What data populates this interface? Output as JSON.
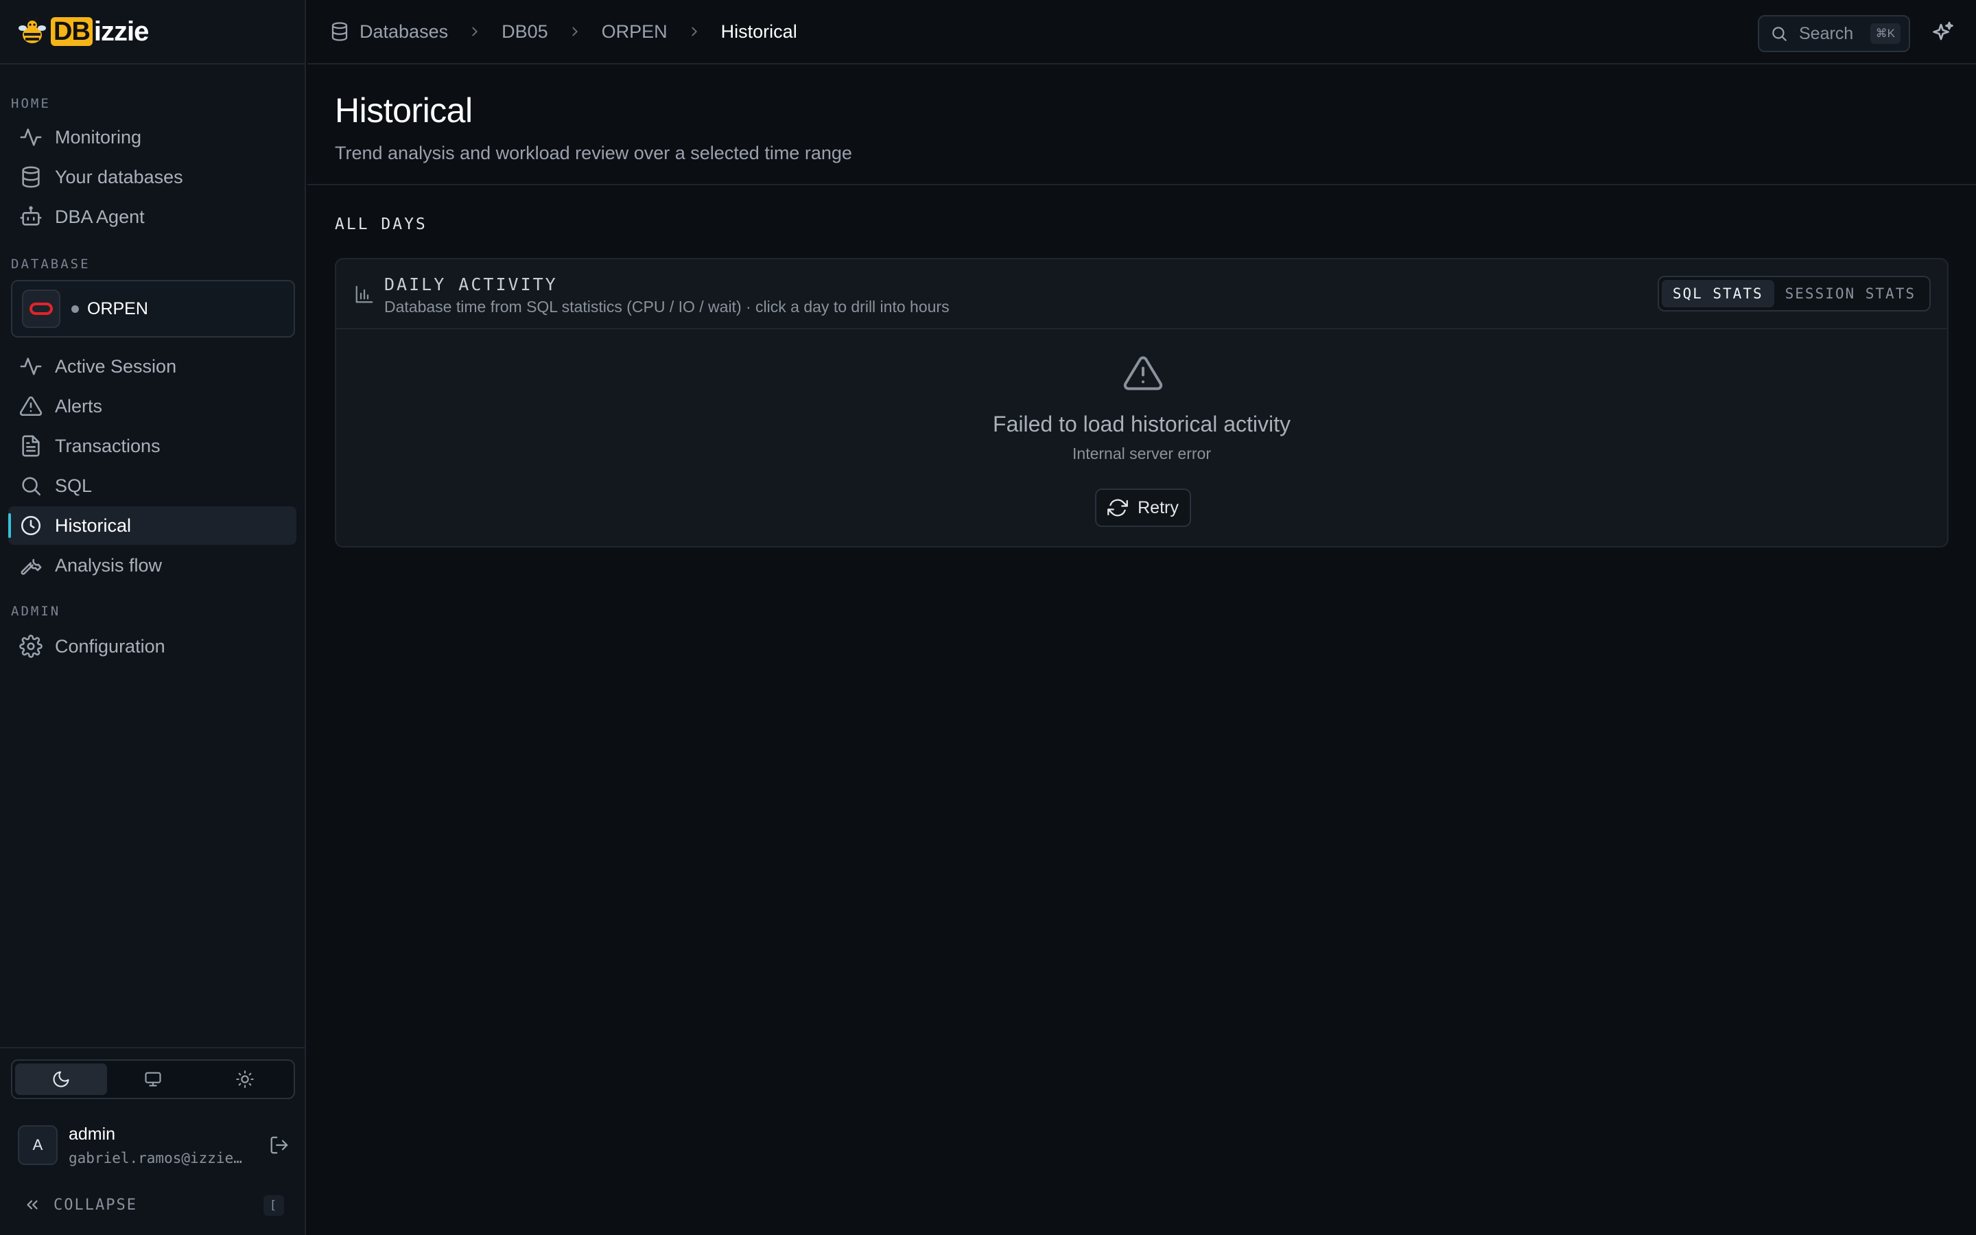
{
  "brand": {
    "prefix": "DB",
    "suffix": "izzie"
  },
  "sidebar": {
    "home_label": "HOME",
    "home_items": [
      {
        "label": "Monitoring",
        "icon": "activity-icon"
      },
      {
        "label": "Your databases",
        "icon": "database-icon"
      },
      {
        "label": "DBA Agent",
        "icon": "bot-icon"
      }
    ],
    "database_label": "DATABASE",
    "database": {
      "name": "ORPEN",
      "status": "unknown",
      "engine_icon": "oracle-icon"
    },
    "db_items": [
      {
        "label": "Active Session",
        "icon": "activity-icon"
      },
      {
        "label": "Alerts",
        "icon": "alert-triangle-icon"
      },
      {
        "label": "Transactions",
        "icon": "file-text-icon"
      },
      {
        "label": "SQL",
        "icon": "search-icon"
      },
      {
        "label": "Historical",
        "icon": "clock-icon",
        "active": true
      },
      {
        "label": "Analysis flow",
        "icon": "wrench-icon"
      }
    ],
    "admin_label": "ADMIN",
    "admin_items": [
      {
        "label": "Configuration",
        "icon": "gear-icon"
      }
    ],
    "theme": {
      "options": [
        "dark",
        "system",
        "light"
      ],
      "selected": "dark"
    },
    "user": {
      "initial": "A",
      "name": "admin",
      "email": "gabriel.ramos@izzie…"
    },
    "collapse_label": "COLLAPSE",
    "collapse_shortcut": "["
  },
  "topbar": {
    "breadcrumbs": [
      "Databases",
      "DB05",
      "ORPEN",
      "Historical"
    ],
    "search_label": "Search",
    "search_shortcut": "⌘K"
  },
  "page": {
    "title": "Historical",
    "subtitle": "Trend analysis and workload review over a selected time range",
    "section_label": "ALL DAYS"
  },
  "panel": {
    "title": "DAILY ACTIVITY",
    "description": "Database time from SQL statistics (CPU / IO / wait) · click a day to drill into hours",
    "toggle": {
      "options": [
        "SQL STATS",
        "SESSION STATS"
      ],
      "selected": "SQL STATS"
    },
    "error": {
      "title": "Failed to load historical activity",
      "message": "Internal server error",
      "retry_label": "Retry"
    }
  },
  "colors": {
    "accent": "#36c2d8",
    "brand": "#f5b417",
    "oracle": "#e0242a",
    "background": "#0b0e13"
  }
}
